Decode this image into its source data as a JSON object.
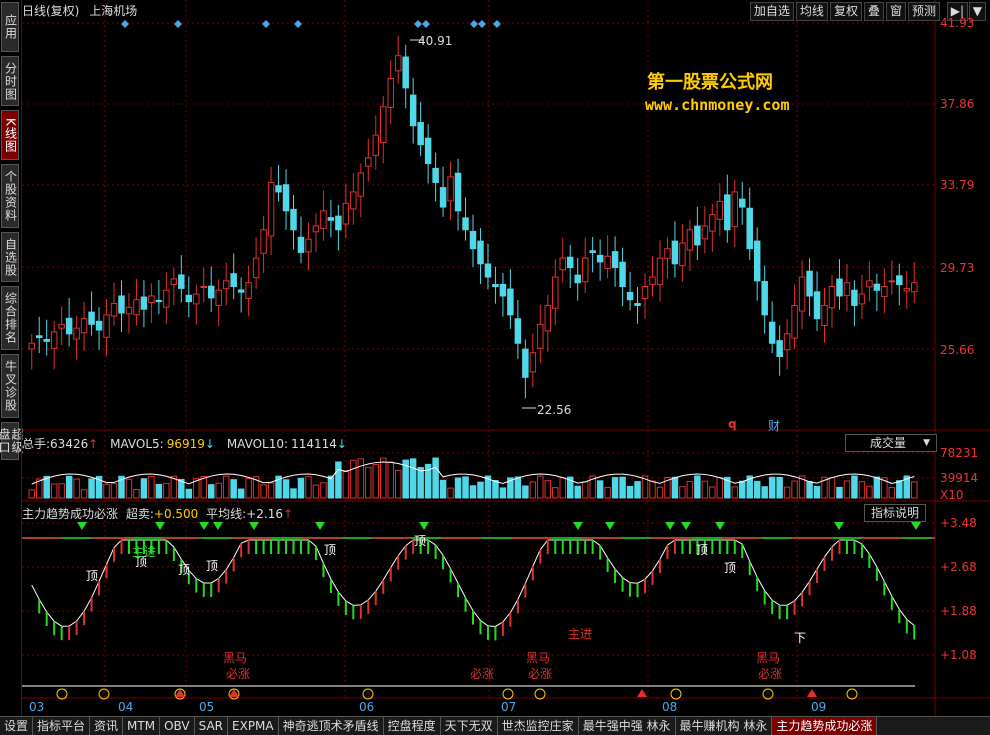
{
  "left_tabs": [
    {
      "label": "应用",
      "active": false
    },
    {
      "label": "分时图",
      "active": false
    },
    {
      "label": "K线图",
      "active": true
    },
    {
      "label": "个股资料",
      "active": false
    },
    {
      "label": "自选股",
      "active": false
    },
    {
      "label": "综合排名",
      "active": false
    },
    {
      "label": "牛叉诊股",
      "active": false
    },
    {
      "label": "超级盘口",
      "active": false
    }
  ],
  "header": {
    "title": "日线(复权)",
    "stock": "上海机场"
  },
  "top_buttons": [
    "加自选",
    "均线",
    "复权",
    "叠",
    "窗",
    "预测"
  ],
  "play_icon": "▶|",
  "menu_icon": "▼",
  "price_scale": [
    "41.93",
    "37.86",
    "33.79",
    "29.73",
    "25.66"
  ],
  "price_annotations": {
    "high": "40.91",
    "low": "22.56"
  },
  "watermark": {
    "line1": "第一股票公式网",
    "line2": "www.chnmoney.com"
  },
  "markers": {
    "q": "q",
    "cai": "财"
  },
  "volume": {
    "label": "总手:",
    "value": "63426",
    "arrow": "↑",
    "mavol5_label": "MAVOL5:",
    "mavol5": "96919",
    "mavol5_arrow": "↓",
    "mavol10_label": "MAVOL10:",
    "mavol10": "114114",
    "mavol10_arrow": "↓",
    "dropdown": "成交量",
    "scale": [
      "78231",
      "39914",
      "X10"
    ]
  },
  "indicator": {
    "name": "主力趋势成功必涨",
    "super_label": "超卖:",
    "super_value": "+0.500",
    "avg_label": "平均线:",
    "avg_value": "+2.16",
    "arrow": "↑",
    "help": "指标说明",
    "scale": [
      "+3.48",
      "+2.68",
      "+1.88",
      "+1.08"
    ],
    "labels": [
      "顶",
      "顶",
      "顶",
      "顶",
      "顶",
      "顶",
      "顶",
      "顶",
      "主进",
      "主进",
      "黑马",
      "必涨",
      "必涨",
      "黑马",
      "必涨",
      "黑马",
      "必涨",
      "下"
    ]
  },
  "months": [
    "03",
    "04",
    "05",
    "06",
    "07",
    "08",
    "09"
  ],
  "bottom_tabs": [
    {
      "label": "设置",
      "active": false
    },
    {
      "label": "指标平台",
      "active": false
    },
    {
      "label": "资讯",
      "active": false
    },
    {
      "label": "MTM",
      "active": false
    },
    {
      "label": "OBV",
      "active": false
    },
    {
      "label": "SAR",
      "active": false
    },
    {
      "label": "EXPMA",
      "active": false
    },
    {
      "label": "神奇逃顶术矛盾线",
      "active": false
    },
    {
      "label": "控盘程度",
      "active": false
    },
    {
      "label": "天下无双",
      "active": false
    },
    {
      "label": "世杰监控庄家",
      "active": false
    },
    {
      "label": "最牛强中强 林永",
      "active": false
    },
    {
      "label": "最牛赚机构 林永",
      "active": false
    },
    {
      "label": "主力趋势成功必涨",
      "active": true
    }
  ],
  "colors": {
    "up": "#e03030",
    "down": "#50d8e8",
    "grid": "#7a0000",
    "green": "#22dd22",
    "white": "#ffffff",
    "blue": "#4aa8e8"
  }
}
